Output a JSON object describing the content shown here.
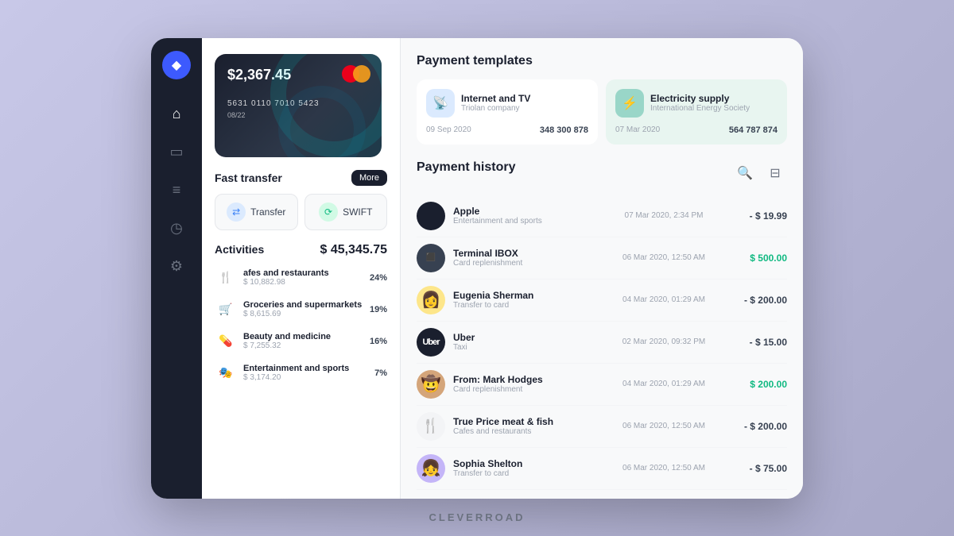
{
  "app": {
    "brand": "CLEVERROAD"
  },
  "sidebar": {
    "logo_symbol": "◆",
    "items": [
      {
        "id": "home",
        "icon": "⌂",
        "active": true
      },
      {
        "id": "card",
        "icon": "▭",
        "active": false
      },
      {
        "id": "list",
        "icon": "≡",
        "active": false
      },
      {
        "id": "clock",
        "icon": "◷",
        "active": false
      },
      {
        "id": "settings",
        "icon": "⚙",
        "active": false
      }
    ]
  },
  "card": {
    "amount": "$2,367.45",
    "number": "5631  0110  7010  5423",
    "expiry": "08/22"
  },
  "fast_transfer": {
    "title": "Fast transfer",
    "more_label": "More",
    "buttons": [
      {
        "label": "Transfer",
        "icon": "↺",
        "style": "blue"
      },
      {
        "label": "SWIFT",
        "icon": "↺",
        "style": "green"
      }
    ]
  },
  "activities": {
    "title": "Activities",
    "total": "$ 45,345.75",
    "items": [
      {
        "icon": "🍴",
        "name": "afes and restaurants",
        "amount": "$ 10,882.98",
        "pct": "24%"
      },
      {
        "icon": "🛒",
        "name": "Groceries and supermarkets",
        "amount": "$ 8,615.69",
        "pct": "19%"
      },
      {
        "icon": "💄",
        "name": "Beauty and medicine",
        "amount": "$ 7,255.32",
        "pct": "16%"
      },
      {
        "icon": "🎭",
        "name": "Entertainment and sports",
        "amount": "$ 3,174.20",
        "pct": "7%"
      }
    ]
  },
  "payment_templates": {
    "title": "Payment templates",
    "items": [
      {
        "name": "Internet and TV",
        "sub": "Triolan company",
        "date": "09 Sep 2020",
        "amount": "348 300 878",
        "icon": "📡",
        "style": "blue"
      },
      {
        "name": "Electricity supply",
        "sub": "International Energy Society",
        "date": "07 Mar 2020",
        "amount": "564 787 874",
        "icon": "⚡",
        "style": "teal"
      }
    ]
  },
  "payment_history": {
    "title": "Payment history",
    "search_icon": "🔍",
    "filter_icon": "⊟",
    "items": [
      {
        "name": "Apple",
        "cat": "Entertainment and sports",
        "date": "07 Mar 2020, 2:34 PM",
        "amount": "- $ 19.99",
        "type": "negative",
        "avatar": ""
      },
      {
        "name": "Terminal IBOX",
        "cat": "Card replenishment",
        "date": "06 Mar 2020, 12:50 AM",
        "amount": "$ 500.00",
        "type": "positive",
        "avatar": "⬛"
      },
      {
        "name": "Eugenia Sherman",
        "cat": "Transfer to card",
        "date": "04 Mar 2020, 01:29 AM",
        "amount": "- $ 200.00",
        "type": "negative",
        "avatar": "👩"
      },
      {
        "name": "Uber",
        "cat": "Taxi",
        "date": "02 Mar 2020, 09:32 PM",
        "amount": "- $ 15.00",
        "type": "negative",
        "avatar": "U"
      },
      {
        "name": "From: Mark Hodges",
        "cat": "Card replenishment",
        "date": "04 Mar 2020, 01:29 AM",
        "amount": "$ 200.00",
        "type": "positive",
        "avatar": "🤠"
      },
      {
        "name": "True Price meat & fish",
        "cat": "Cafes and restaurants",
        "date": "06 Mar 2020, 12:50 AM",
        "amount": "- $ 200.00",
        "type": "negative",
        "avatar": "🍴"
      },
      {
        "name": "Sophia Shelton",
        "cat": "Transfer to card",
        "date": "06 Mar 2020, 12:50 AM",
        "amount": "- $ 75.00",
        "type": "negative",
        "avatar": "👧"
      }
    ]
  }
}
